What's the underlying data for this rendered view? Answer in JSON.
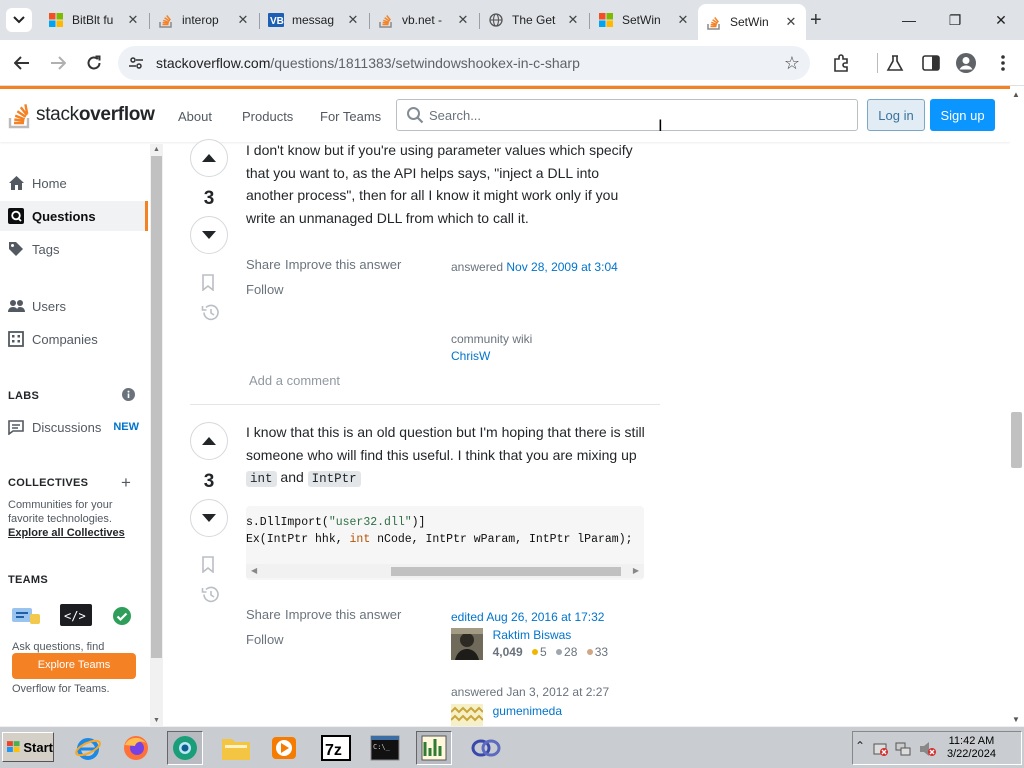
{
  "browser": {
    "tabs": [
      {
        "title": "BitBlt fu",
        "favicon": "microsoft-logo-icon"
      },
      {
        "title": "interop",
        "favicon": "stackoverflow-icon"
      },
      {
        "title": "messag",
        "favicon": "vb-icon"
      },
      {
        "title": "vb.net -",
        "favicon": "stackoverflow-icon"
      },
      {
        "title": "The Get",
        "favicon": "globe-icon"
      },
      {
        "title": "SetWin",
        "favicon": "microsoft-logo-icon"
      },
      {
        "title": "SetWin",
        "favicon": "stackoverflow-icon",
        "active": true
      }
    ],
    "url_host": "stackoverflow.com",
    "url_path": "/questions/1811383/setwindowshookex-in-c-sharp"
  },
  "so_header": {
    "logo_light": "stack",
    "logo_bold": "overflow",
    "nav": [
      "About",
      "Products",
      "For Teams"
    ],
    "search_placeholder": "Search...",
    "login": "Log in",
    "signup": "Sign up"
  },
  "sidebar": {
    "home": "Home",
    "questions": "Questions",
    "tags": "Tags",
    "users": "Users",
    "companies": "Companies",
    "labs_heading": "LABS",
    "discussions": "Discussions",
    "new_badge": "NEW",
    "collectives_heading": "COLLECTIVES",
    "collectives_text": "Communities for your favorite technologies.",
    "explore_collectives": "Explore all Collectives",
    "teams_heading": "TEAMS",
    "teams_text": "Ask questions, find answers and collaborate at work with Stack Overflow for Teams.",
    "explore_teams": "Explore Teams"
  },
  "answers": [
    {
      "score": "3",
      "text": "I don't know but if you're using parameter values which specify that you want to, as the API helps says, \"inject a DLL into another process\", then for all I know it might work only if you write an unmanaged DLL from which to call it.",
      "share": "Share",
      "improve": "Improve this answer",
      "follow": "Follow",
      "answered_label": "answered",
      "answered_date": "Nov 28, 2009 at 3:04",
      "community": "community wiki",
      "author": "ChrisW",
      "add_comment": "Add a comment"
    },
    {
      "score": "3",
      "text_before": "I know that this is an old question but I'm hoping that there is still someone who will find this useful. I think that you are mixing up",
      "code1": "int",
      "text_and": "and",
      "code2": "IntPtr",
      "code_line1_a": "s.DllImport(",
      "code_line1_str": "\"user32.dll\"",
      "code_line1_b": ")]",
      "code_line2_a": "Ex(IntPtr hhk, ",
      "code_line2_kw": "int",
      "code_line2_b": " nCode, IntPtr wParam, IntPtr lParam);",
      "share": "Share",
      "improve": "Improve this answer",
      "follow": "Follow",
      "edited_label": "edited Aug 26, 2016 at 17:32",
      "editor": "Raktim Biswas",
      "editor_rep": "4,049",
      "editor_gold": "5",
      "editor_silver": "28",
      "editor_bronze": "33",
      "answered_label": "answered Jan 3, 2012 at 2:27",
      "author": "gumenimeda"
    }
  ],
  "taskbar": {
    "start": "Start",
    "time": "11:42 AM",
    "date": "3/22/2024",
    "apps": [
      "internet-explorer-icon",
      "firefox-icon",
      "chrome-like-icon",
      "folder-icon",
      "media-player-icon",
      "7zip-icon",
      "cmd-icon",
      "chart-app-icon",
      "eclipse-icon"
    ]
  },
  "colors": {
    "so_orange": "#f48225",
    "so_blue": "#0a95ff",
    "link_blue": "#0074cc"
  }
}
